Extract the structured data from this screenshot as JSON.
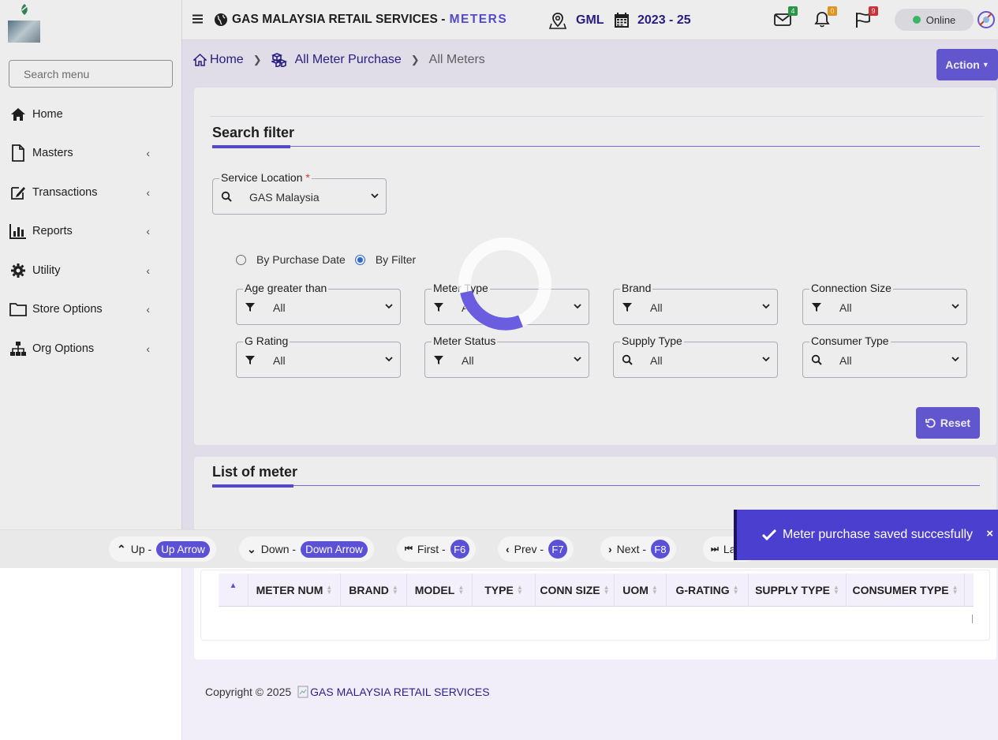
{
  "header": {
    "app_title": "GAS MALAYSIA RETAIL SERVICES -",
    "module": "METERS",
    "location": "GML",
    "year": "2023 - 25",
    "mail_count": "4",
    "notif_count": "0",
    "flag_count": "9",
    "status": "Online",
    "colors": {
      "accent": "#5b50d6",
      "dark": "#2a1f8a",
      "online": "#3ec46d"
    }
  },
  "sidebar": {
    "search_placeholder": "Search menu",
    "items": [
      {
        "label": "Home",
        "icon": "home-icon"
      },
      {
        "label": "Masters",
        "icon": "file-icon"
      },
      {
        "label": "Transactions",
        "icon": "edit-icon"
      },
      {
        "label": "Reports",
        "icon": "bar-chart-icon"
      },
      {
        "label": "Utility",
        "icon": "gear-icon"
      },
      {
        "label": "Store Options",
        "icon": "folder-icon"
      },
      {
        "label": "Org Options",
        "icon": "sitemap-icon"
      }
    ]
  },
  "breadcrumb": {
    "home": "Home",
    "parent": "All Meter Purchase",
    "current": "All Meters"
  },
  "action_label": "Action",
  "search_filter": {
    "title": "Search filter",
    "service_location": {
      "label": "Service Location",
      "required": "*",
      "value": "GAS Malaysia"
    },
    "radio_purchase_date": "By Purchase Date",
    "radio_filter": "By Filter",
    "filters": [
      {
        "label": "Age greater than",
        "value": "All",
        "icon": "filter-icon"
      },
      {
        "label": "Meter Type",
        "value": "All",
        "icon": "filter-icon"
      },
      {
        "label": "Brand",
        "value": "All",
        "icon": "filter-icon"
      },
      {
        "label": "Connection Size",
        "value": "All",
        "icon": "filter-icon"
      },
      {
        "label": "G Rating",
        "value": "All",
        "icon": "filter-icon"
      },
      {
        "label": "Meter Status",
        "value": "All",
        "icon": "filter-icon"
      },
      {
        "label": "Supply Type",
        "value": "All",
        "icon": "search-icon"
      },
      {
        "label": "Consumer Type",
        "value": "All",
        "icon": "search-icon"
      }
    ],
    "reset_label": "Reset"
  },
  "list": {
    "title": "List of meter",
    "columns": [
      "METER NUM",
      "BRAND",
      "MODEL",
      "TYPE",
      "CONN SIZE",
      "UOM",
      "G-RATING",
      "SUPPLY TYPE",
      "CONSUMER TYPE"
    ]
  },
  "shortcuts": [
    {
      "label": "Up -",
      "key": "Up Arrow"
    },
    {
      "label": "Down -",
      "key": "Down Arrow"
    },
    {
      "label": "First -",
      "key": "F6"
    },
    {
      "label": "Prev -",
      "key": "F7"
    },
    {
      "label": "Next -",
      "key": "F8"
    },
    {
      "label": "La"
    }
  ],
  "toast": {
    "message": "Meter purchase saved succesfully",
    "close": "×"
  },
  "footer": {
    "copyright": "Copyright © 2025",
    "brand_alt": "GAS MALAYSIA RETAIL SERVICES"
  }
}
